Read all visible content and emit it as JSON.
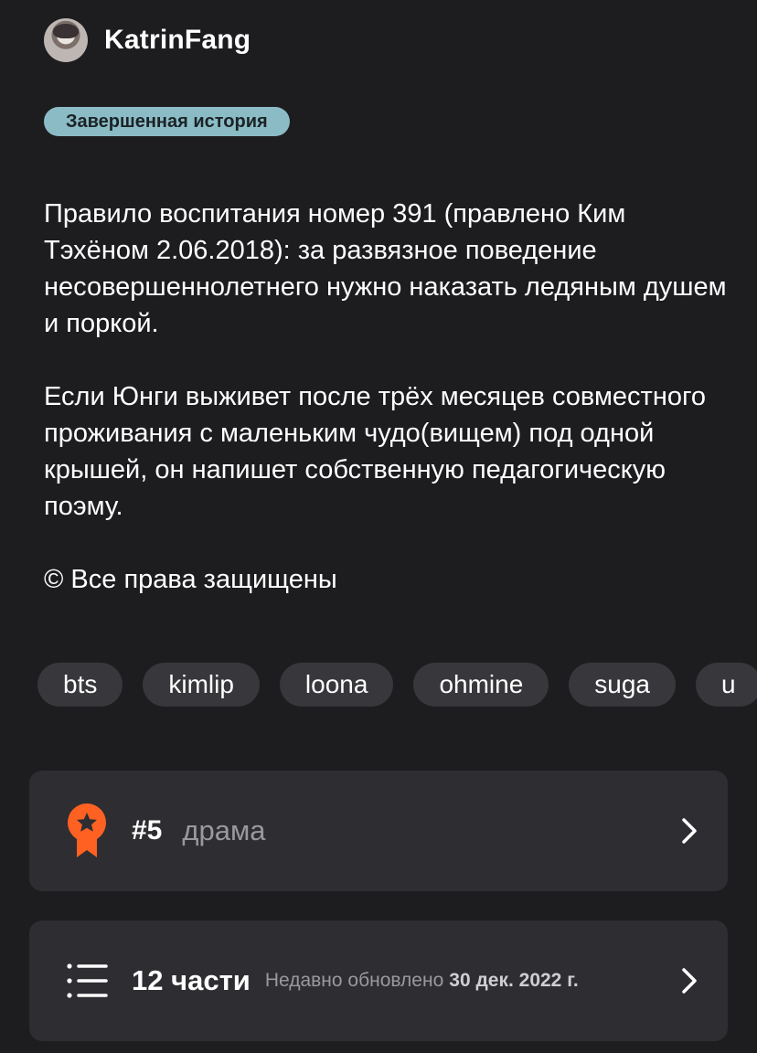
{
  "author": {
    "name": "KatrinFang"
  },
  "status_badge": "Завершенная история",
  "description": {
    "paragraph1": "Правило воспитания номер 391 (правлено Ким Тэхёном 2.06.2018): за развязное поведение несовершеннолетнего нужно наказать ледяным душем и поркой.",
    "paragraph2": "Если Юнги выживет после трёх месяцев совместного проживания с маленьким чудо(вищем) под одной крышей, он напишет собственную педагогическую поэму.",
    "copyright": "© Все права защищены"
  },
  "tags": [
    "bts",
    "kimlip",
    "loona",
    "ohmine",
    "suga",
    "u"
  ],
  "rank_card": {
    "rank": "#5",
    "genre": "драма",
    "icon": "medal-icon"
  },
  "parts_card": {
    "count": "12 части",
    "updated_label": "Недавно обновлено",
    "updated_date": "30 дек. 2022 г.",
    "icon": "list-icon"
  },
  "colors": {
    "background": "#1d1c1f",
    "card": "#2e2d31",
    "tag": "#38373b",
    "badge": "#8bbcc6",
    "medal": "#ff6122",
    "muted_text": "#9a999d"
  }
}
